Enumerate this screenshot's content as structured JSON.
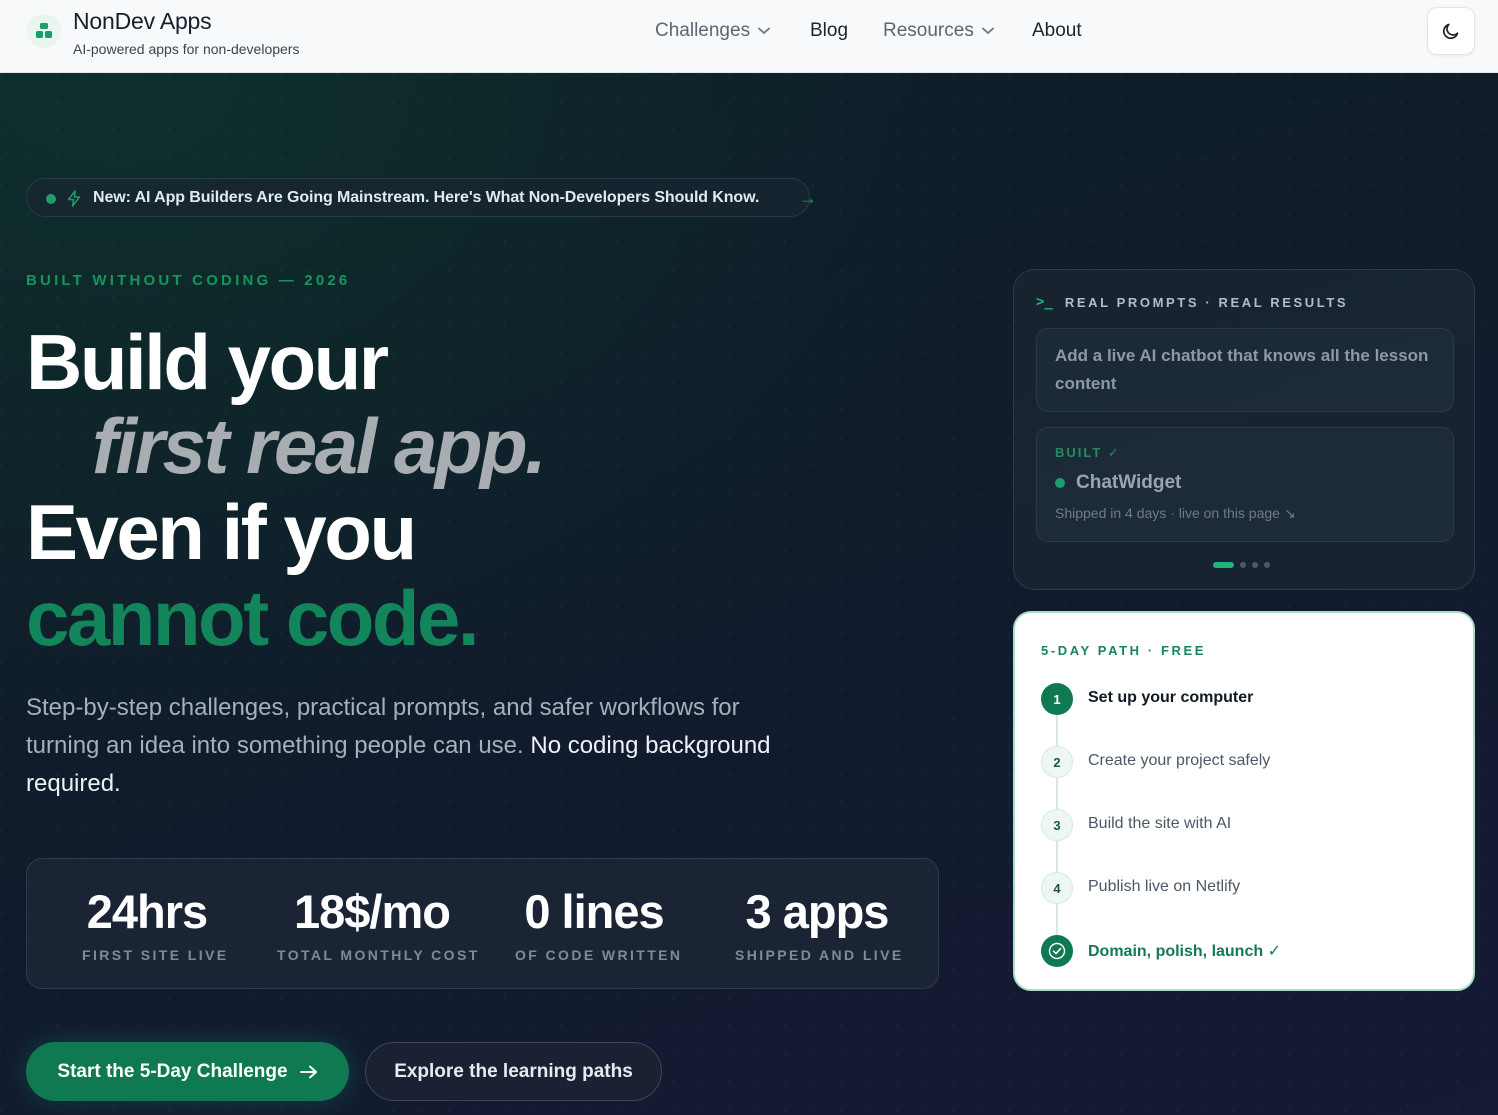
{
  "brand": {
    "name": "NonDev Apps",
    "tagline": "AI-powered apps for non-developers"
  },
  "nav": {
    "items": [
      {
        "label": "Challenges",
        "dropdown": true
      },
      {
        "label": "Blog",
        "dropdown": false
      },
      {
        "label": "Resources",
        "dropdown": true
      },
      {
        "label": "About",
        "dropdown": false
      }
    ],
    "theme_toggle_icon": "moon-icon"
  },
  "announcement": {
    "text": "New: AI App Builders Are Going Mainstream. Here's What Non-Developers Should Know.",
    "arrow": "→"
  },
  "hero": {
    "eyebrow": "BUILT WITHOUT CODING — 2026",
    "headline": {
      "line1": "Build your",
      "line2": "first real app.",
      "line3": "Even if you",
      "line4": "cannot code."
    },
    "lede_main": "Step-by-step challenges, practical prompts, and safer workflows for turning an idea into something people can use.",
    "lede_emphasis": "No coding background required."
  },
  "stats": [
    {
      "value": "24hrs",
      "label": "FIRST SITE LIVE"
    },
    {
      "value": "18$/mo",
      "label": "TOTAL MONTHLY COST"
    },
    {
      "value": "0 lines",
      "label": "OF CODE WRITTEN"
    },
    {
      "value": "3 apps",
      "label": "SHIPPED AND LIVE"
    }
  ],
  "cta": {
    "primary": "Start the 5-Day Challenge",
    "secondary": "Explore the learning paths"
  },
  "prompt_card": {
    "symbol": ">_",
    "heading": "REAL PROMPTS · REAL RESULTS",
    "prompt": "Add a live AI chatbot that knows all the lesson content",
    "result_badge": "BUILT ✓",
    "result_name": "ChatWidget",
    "result_meta": "Shipped in 4 days · live on this page ↘",
    "carousel_total": 4,
    "carousel_active": 1
  },
  "path_card": {
    "title": "5-DAY PATH · FREE",
    "steps": [
      {
        "num": "1",
        "label": "Set up your computer"
      },
      {
        "num": "2",
        "label": "Create your project safely"
      },
      {
        "num": "3",
        "label": "Build the site with AI"
      },
      {
        "num": "4",
        "label": "Publish live on Netlify"
      },
      {
        "num": "",
        "label": "Domain, polish, launch ✓"
      }
    ]
  },
  "colors": {
    "accent": "#0f7a52",
    "accent_bright": "#1fb27b",
    "header_bg": "#f7f9fb",
    "hero_bg": "#0f1a26"
  }
}
